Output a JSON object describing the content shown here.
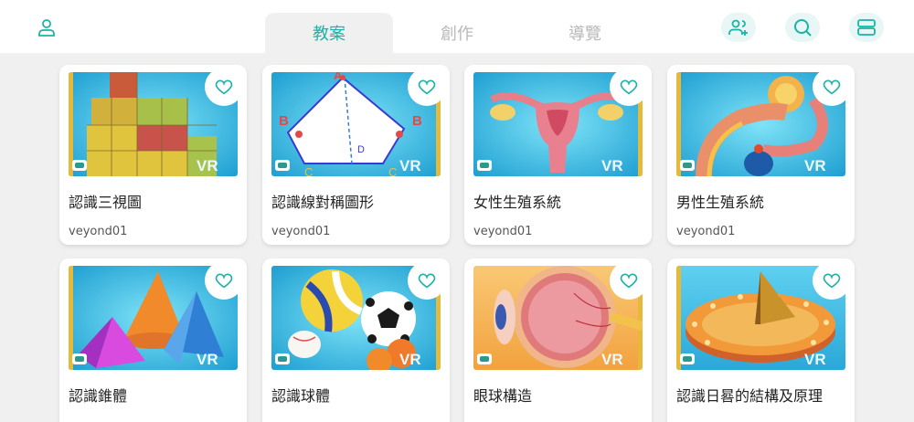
{
  "header": {
    "tabs": [
      {
        "label": "教案",
        "active": true
      },
      {
        "label": "創作",
        "active": false
      },
      {
        "label": "導覽",
        "active": false
      }
    ],
    "icons": [
      "user-icon",
      "add-user-icon",
      "search-icon",
      "menu-icon"
    ]
  },
  "theme": {
    "accent": "#1ab3a6",
    "background": "#f0f0f0"
  },
  "cards": [
    {
      "title": "認識三視圖",
      "author": "veyond01",
      "vr_label": "VR",
      "thumbnail": "cubes"
    },
    {
      "title": "認識線對稱圖形",
      "author": "veyond01",
      "vr_label": "VR",
      "thumbnail": "kite",
      "diagram_labels": [
        "A",
        "B",
        "B",
        "D",
        "C",
        "C"
      ]
    },
    {
      "title": "女性生殖系統",
      "author": "veyond01",
      "vr_label": "VR",
      "thumbnail": "uterus"
    },
    {
      "title": "男性生殖系統",
      "author": "veyond01",
      "vr_label": "VR",
      "thumbnail": "male-anatomy"
    },
    {
      "title": "認識錐體",
      "author": "",
      "vr_label": "VR",
      "thumbnail": "cones"
    },
    {
      "title": "認識球體",
      "author": "",
      "vr_label": "VR",
      "thumbnail": "balls"
    },
    {
      "title": "眼球構造",
      "author": "",
      "vr_label": "VR",
      "thumbnail": "eye"
    },
    {
      "title": "認識日晷的結構及原理",
      "author": "",
      "vr_label": "VR",
      "thumbnail": "sundial"
    }
  ]
}
